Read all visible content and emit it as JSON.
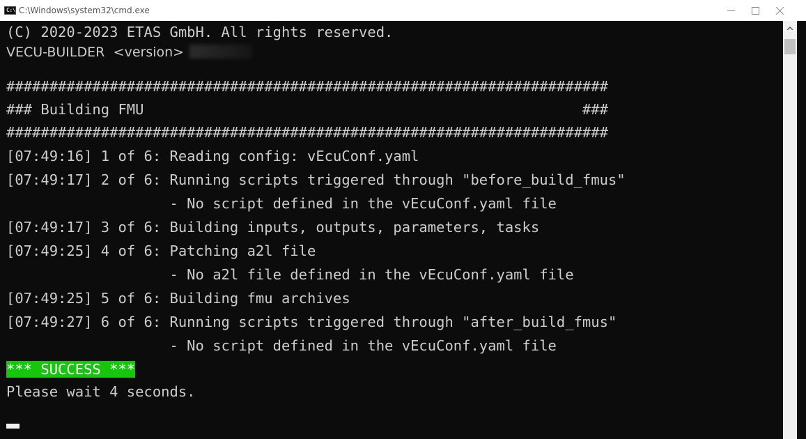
{
  "window": {
    "title": "C:\\Windows\\system32\\cmd.exe",
    "icon_label": "C:\\",
    "icons": {
      "minimize": "minimize-icon",
      "maximize": "maximize-icon",
      "close": "close-icon"
    }
  },
  "terminal": {
    "lines": [
      "(C) 2020-2023 ETAS GmbH. All rights reserved.",
      "VECU-BUILDER <version>",
      "######################################################################",
      "### Building FMU                                                   ###",
      "######################################################################",
      "[07:49:16] 1 of 6: Reading config: vEcuConf.yaml",
      "[07:49:17] 2 of 6: Running scripts triggered through \"before_build_fmus\"",
      "                   - No script defined in the vEcuConf.yaml file",
      "[07:49:17] 3 of 6: Building inputs, outputs, parameters, tasks",
      "[07:49:25] 4 of 6: Patching a2l file",
      "                   - No a2l file defined in the vEcuConf.yaml file",
      "[07:49:25] 5 of 6: Building fmu archives",
      "[07:49:27] 6 of 6: Running scripts triggered through \"after_build_fmus\"",
      "                   - No script defined in the vEcuConf.yaml file",
      "*** SUCCESS ***",
      "Please wait 4 seconds."
    ],
    "builder_name": "VECU-BUILDER",
    "builder_version": "<version>"
  },
  "colors": {
    "background": "#0c0c0c",
    "text": "#cccccc",
    "success_bg": "#16c60c",
    "success_text": "#ffffff"
  }
}
